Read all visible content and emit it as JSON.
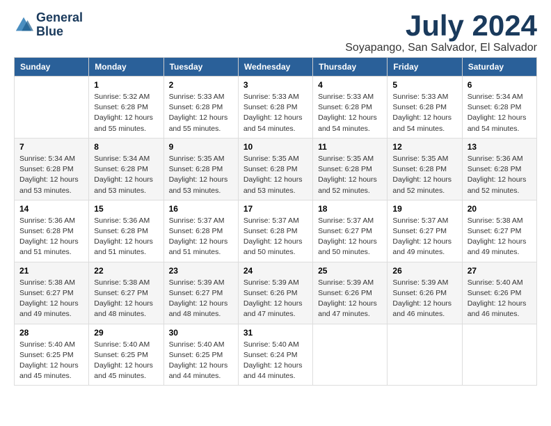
{
  "header": {
    "logo_line1": "General",
    "logo_line2": "Blue",
    "title": "July 2024",
    "location": "Soyapango, San Salvador, El Salvador"
  },
  "weekdays": [
    "Sunday",
    "Monday",
    "Tuesday",
    "Wednesday",
    "Thursday",
    "Friday",
    "Saturday"
  ],
  "weeks": [
    [
      {
        "num": "",
        "detail": ""
      },
      {
        "num": "1",
        "detail": "Sunrise: 5:32 AM\nSunset: 6:28 PM\nDaylight: 12 hours\nand 55 minutes."
      },
      {
        "num": "2",
        "detail": "Sunrise: 5:33 AM\nSunset: 6:28 PM\nDaylight: 12 hours\nand 55 minutes."
      },
      {
        "num": "3",
        "detail": "Sunrise: 5:33 AM\nSunset: 6:28 PM\nDaylight: 12 hours\nand 54 minutes."
      },
      {
        "num": "4",
        "detail": "Sunrise: 5:33 AM\nSunset: 6:28 PM\nDaylight: 12 hours\nand 54 minutes."
      },
      {
        "num": "5",
        "detail": "Sunrise: 5:33 AM\nSunset: 6:28 PM\nDaylight: 12 hours\nand 54 minutes."
      },
      {
        "num": "6",
        "detail": "Sunrise: 5:34 AM\nSunset: 6:28 PM\nDaylight: 12 hours\nand 54 minutes."
      }
    ],
    [
      {
        "num": "7",
        "detail": "Sunrise: 5:34 AM\nSunset: 6:28 PM\nDaylight: 12 hours\nand 53 minutes."
      },
      {
        "num": "8",
        "detail": "Sunrise: 5:34 AM\nSunset: 6:28 PM\nDaylight: 12 hours\nand 53 minutes."
      },
      {
        "num": "9",
        "detail": "Sunrise: 5:35 AM\nSunset: 6:28 PM\nDaylight: 12 hours\nand 53 minutes."
      },
      {
        "num": "10",
        "detail": "Sunrise: 5:35 AM\nSunset: 6:28 PM\nDaylight: 12 hours\nand 53 minutes."
      },
      {
        "num": "11",
        "detail": "Sunrise: 5:35 AM\nSunset: 6:28 PM\nDaylight: 12 hours\nand 52 minutes."
      },
      {
        "num": "12",
        "detail": "Sunrise: 5:35 AM\nSunset: 6:28 PM\nDaylight: 12 hours\nand 52 minutes."
      },
      {
        "num": "13",
        "detail": "Sunrise: 5:36 AM\nSunset: 6:28 PM\nDaylight: 12 hours\nand 52 minutes."
      }
    ],
    [
      {
        "num": "14",
        "detail": "Sunrise: 5:36 AM\nSunset: 6:28 PM\nDaylight: 12 hours\nand 51 minutes."
      },
      {
        "num": "15",
        "detail": "Sunrise: 5:36 AM\nSunset: 6:28 PM\nDaylight: 12 hours\nand 51 minutes."
      },
      {
        "num": "16",
        "detail": "Sunrise: 5:37 AM\nSunset: 6:28 PM\nDaylight: 12 hours\nand 51 minutes."
      },
      {
        "num": "17",
        "detail": "Sunrise: 5:37 AM\nSunset: 6:28 PM\nDaylight: 12 hours\nand 50 minutes."
      },
      {
        "num": "18",
        "detail": "Sunrise: 5:37 AM\nSunset: 6:27 PM\nDaylight: 12 hours\nand 50 minutes."
      },
      {
        "num": "19",
        "detail": "Sunrise: 5:37 AM\nSunset: 6:27 PM\nDaylight: 12 hours\nand 49 minutes."
      },
      {
        "num": "20",
        "detail": "Sunrise: 5:38 AM\nSunset: 6:27 PM\nDaylight: 12 hours\nand 49 minutes."
      }
    ],
    [
      {
        "num": "21",
        "detail": "Sunrise: 5:38 AM\nSunset: 6:27 PM\nDaylight: 12 hours\nand 49 minutes."
      },
      {
        "num": "22",
        "detail": "Sunrise: 5:38 AM\nSunset: 6:27 PM\nDaylight: 12 hours\nand 48 minutes."
      },
      {
        "num": "23",
        "detail": "Sunrise: 5:39 AM\nSunset: 6:27 PM\nDaylight: 12 hours\nand 48 minutes."
      },
      {
        "num": "24",
        "detail": "Sunrise: 5:39 AM\nSunset: 6:26 PM\nDaylight: 12 hours\nand 47 minutes."
      },
      {
        "num": "25",
        "detail": "Sunrise: 5:39 AM\nSunset: 6:26 PM\nDaylight: 12 hours\nand 47 minutes."
      },
      {
        "num": "26",
        "detail": "Sunrise: 5:39 AM\nSunset: 6:26 PM\nDaylight: 12 hours\nand 46 minutes."
      },
      {
        "num": "27",
        "detail": "Sunrise: 5:40 AM\nSunset: 6:26 PM\nDaylight: 12 hours\nand 46 minutes."
      }
    ],
    [
      {
        "num": "28",
        "detail": "Sunrise: 5:40 AM\nSunset: 6:25 PM\nDaylight: 12 hours\nand 45 minutes."
      },
      {
        "num": "29",
        "detail": "Sunrise: 5:40 AM\nSunset: 6:25 PM\nDaylight: 12 hours\nand 45 minutes."
      },
      {
        "num": "30",
        "detail": "Sunrise: 5:40 AM\nSunset: 6:25 PM\nDaylight: 12 hours\nand 44 minutes."
      },
      {
        "num": "31",
        "detail": "Sunrise: 5:40 AM\nSunset: 6:24 PM\nDaylight: 12 hours\nand 44 minutes."
      },
      {
        "num": "",
        "detail": ""
      },
      {
        "num": "",
        "detail": ""
      },
      {
        "num": "",
        "detail": ""
      }
    ]
  ]
}
